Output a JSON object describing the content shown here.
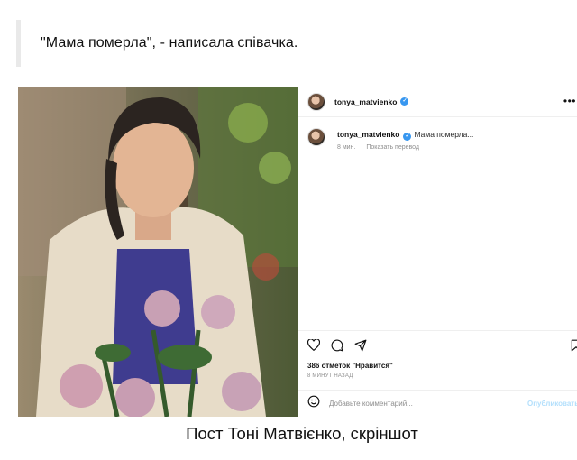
{
  "quote": {
    "text": "\"Мама померла\", - написала співачка."
  },
  "instagram": {
    "username": "tonya_matvienko",
    "more_icon": "ellipsis-icon",
    "comment": {
      "username": "tonya_matvienko",
      "text": "Мама померла...",
      "time": "8 мин.",
      "translate": "Показать перевод"
    },
    "actions": [
      "heart-icon",
      "comment-icon",
      "share-icon",
      "bookmark-icon"
    ],
    "likes": "386 отметок \"Нравится\"",
    "posted_ago": "8 минут назад",
    "add_comment_placeholder": "Добавьте комментарий...",
    "publish_label": "Опубликовать",
    "colors": {
      "verified": "#3897f0",
      "publish": "#b2dffc",
      "muted": "#8e8e8e"
    }
  },
  "caption": "Пост Тоні Матвієнко, скріншот"
}
